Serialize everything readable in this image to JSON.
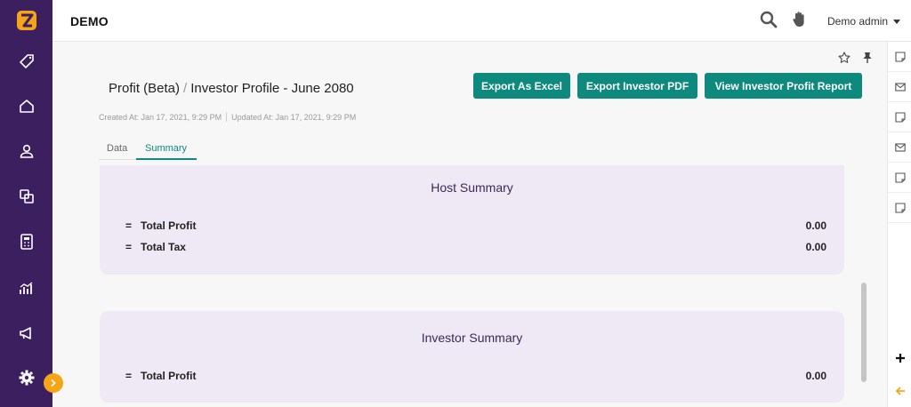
{
  "header": {
    "brand": "DEMO",
    "user_name": "Demo admin",
    "search_icon": "search-icon",
    "hand_icon": "hand-icon"
  },
  "sidebar": {
    "logo_icon": "z-logo-icon",
    "items": [
      {
        "icon": "tag-icon"
      },
      {
        "icon": "home-icon"
      },
      {
        "icon": "user-icon"
      },
      {
        "icon": "exchange-icon"
      },
      {
        "icon": "calculator-icon"
      },
      {
        "icon": "chart-icon"
      },
      {
        "icon": "megaphone-icon"
      },
      {
        "icon": "gear-icon"
      }
    ],
    "toggle_icon": "chevron-right-icon"
  },
  "page": {
    "title_parent": "Profit (Beta)",
    "title_separator": "/",
    "title_current": "Investor Profile - June 2080",
    "created_at": "Created At: Jan 17, 2021, 9:29 PM",
    "updated_at": "Updated At: Jan 17, 2021, 9:29 PM"
  },
  "actions": {
    "export_excel": "Export As Excel",
    "export_pdf": "Export Investor PDF",
    "view_report": "View Investor Profit Report"
  },
  "tabs": [
    {
      "label": "Data",
      "active": false
    },
    {
      "label": "Summary",
      "active": true
    }
  ],
  "host_summary": {
    "title": "Host Summary",
    "rows": [
      {
        "symbol": "=",
        "label": "Total Profit",
        "value": "0.00"
      },
      {
        "symbol": "=",
        "label": "Total Tax",
        "value": "0.00"
      }
    ]
  },
  "investor_summary": {
    "title": "Investor Summary",
    "rows": [
      {
        "symbol": "=",
        "label": "Total Profit",
        "value": "0.00"
      }
    ]
  },
  "colors": {
    "sidebar": "#3b1f5e",
    "accent": "#0d8a7d",
    "logo": "#f5a516",
    "card": "#efe9f5"
  }
}
